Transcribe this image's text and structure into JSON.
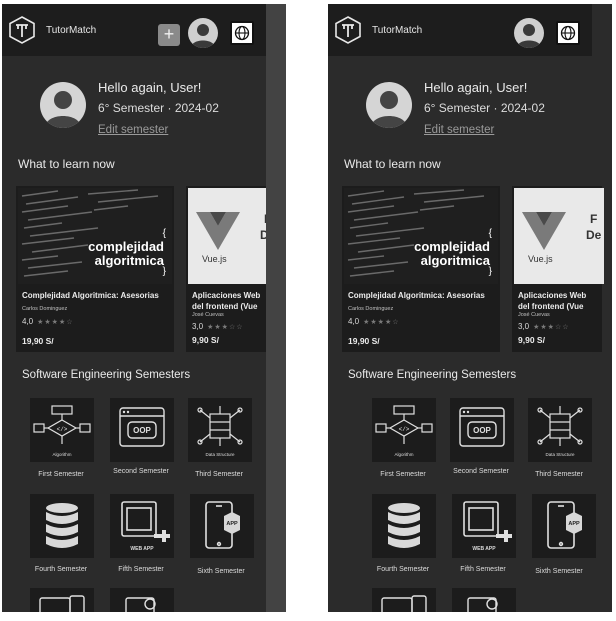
{
  "screens": [
    {
      "app": {
        "name": "TutorMatch",
        "show_add_button": true
      },
      "greeting": {
        "hello": "Hello again, User!",
        "semester": "6° Semester · 2024-02",
        "edit_link": "Edit semester"
      },
      "learn_section": {
        "title": "What to learn now",
        "courses": [
          {
            "image_text_line1": "complejidad",
            "image_text_line2": "algoritmica",
            "title": "Complejidad Algoritmica: Asesorias",
            "author": "Carlos Dominguez",
            "rating": "4,0",
            "stars": 4,
            "price": "19,90 S/"
          },
          {
            "image_text": "Vue.js",
            "image_text_partial1": "F",
            "image_text_partial2": "De",
            "title_line1": "Aplicaciones Web",
            "title_line2": "del frontend (Vue",
            "author": "José Cuevas",
            "rating": "3,0",
            "stars": 3,
            "price": "9,90 S/"
          }
        ]
      },
      "semesters_section": {
        "title": "Software Engineering Semesters",
        "items": [
          {
            "label": "First Semester",
            "icon": "algorithm-icon",
            "icon_text": "Algorithm"
          },
          {
            "label": "Second Semester",
            "icon": "oop-icon",
            "icon_text": "OOP"
          },
          {
            "label": "Third Semester",
            "icon": "data-structure-icon",
            "icon_text": "Data Structure"
          },
          {
            "label": "Fourth Semester",
            "icon": "database-icon"
          },
          {
            "label": "Fifth Semester",
            "icon": "web-app-icon",
            "icon_text": "WEB APP"
          },
          {
            "label": "Sixth Semester",
            "icon": "mobile-app-icon",
            "icon_text": "APP"
          }
        ]
      }
    },
    {
      "app": {
        "name": "TutorMatch",
        "show_add_button": false
      },
      "greeting": {
        "hello": "Hello again, User!",
        "semester": "6° Semester · 2024-02",
        "edit_link": "Edit semester"
      },
      "learn_section": {
        "title": "What to learn now",
        "courses": [
          {
            "image_text_line1": "complejidad",
            "image_text_line2": "algoritmica",
            "title": "Complejidad Algoritmica: Asesorias",
            "author": "Carlos Dominguez",
            "rating": "4,0",
            "stars": 4,
            "price": "19,90 S/"
          },
          {
            "image_text": "Vue.js",
            "image_text_partial1": "F",
            "image_text_partial2": "De",
            "title_line1": "Aplicaciones Web",
            "title_line2": "del frontend (Vue",
            "author": "José Cuevas",
            "rating": "3,0",
            "stars": 3,
            "price": "9,90 S/"
          }
        ]
      },
      "semesters_section": {
        "title": "Software Engineering Semesters",
        "items": [
          {
            "label": "First Semester",
            "icon": "algorithm-icon",
            "icon_text": "Algorithm"
          },
          {
            "label": "Second Semester",
            "icon": "oop-icon",
            "icon_text": "OOP"
          },
          {
            "label": "Third Semester",
            "icon": "data-structure-icon",
            "icon_text": "Data Structure"
          },
          {
            "label": "Fourth Semester",
            "icon": "database-icon"
          },
          {
            "label": "Fifth Semester",
            "icon": "web-app-icon",
            "icon_text": "WEB APP"
          },
          {
            "label": "Sixth Semester",
            "icon": "mobile-app-icon",
            "icon_text": "APP"
          }
        ]
      }
    }
  ]
}
